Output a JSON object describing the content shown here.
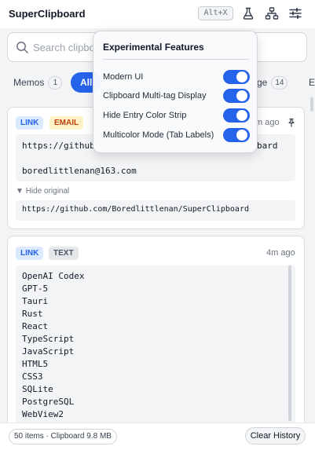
{
  "app": {
    "title": "SuperClipboard",
    "shortcut": "Alt+X"
  },
  "toolbar": {
    "icons": [
      "flask-icon",
      "hierarchy-icon",
      "sliders-icon"
    ]
  },
  "search": {
    "value": "",
    "placeholder": "Search clipboard"
  },
  "tabs": [
    {
      "label": "Memos",
      "count": "1",
      "active": false
    },
    {
      "label": "All",
      "count": "",
      "active": true
    },
    {
      "label": "ge",
      "count": "14",
      "active": false
    },
    {
      "label": "E",
      "count": "",
      "active": false
    }
  ],
  "entries": [
    {
      "tags": [
        "LINK",
        "EMAIL"
      ],
      "time": "m ago",
      "pinned": true,
      "lines": [
        "https://github",
        "bard",
        "",
        "boredlittlenan@163.com"
      ],
      "hide_label": "Hide original",
      "original": "https://github.com/Boredlittlenan/SuperClipboard"
    },
    {
      "tags": [
        "LINK",
        "TEXT"
      ],
      "time": "4m ago",
      "pinned": false,
      "lines": [
        "OpenAI Codex",
        "GPT-5",
        "Tauri",
        "Rust",
        "React",
        "TypeScript",
        "JavaScript",
        "HTML5",
        "CSS3",
        "SQLite",
        "PostgreSQL",
        "WebView2"
      ]
    }
  ],
  "footer": {
    "stats": "50 items · Clipboard 9.8 MB",
    "clear_label": "Clear History"
  },
  "popover": {
    "title": "Experimental Features",
    "options": [
      {
        "label": "Modern UI",
        "enabled": true
      },
      {
        "label": "Clipboard Multi-tag Display",
        "enabled": true
      },
      {
        "label": "Hide Entry Color Strip",
        "enabled": true
      },
      {
        "label": "Multicolor Mode (Tab Labels)",
        "enabled": true
      }
    ]
  },
  "colors": {
    "accent": "#2563eb",
    "link_tag_bg": "#dbeafe",
    "email_tag_bg": "#fef3c7",
    "email_tag_text": "#c2410c",
    "text_tag_bg": "#e5e7eb"
  }
}
